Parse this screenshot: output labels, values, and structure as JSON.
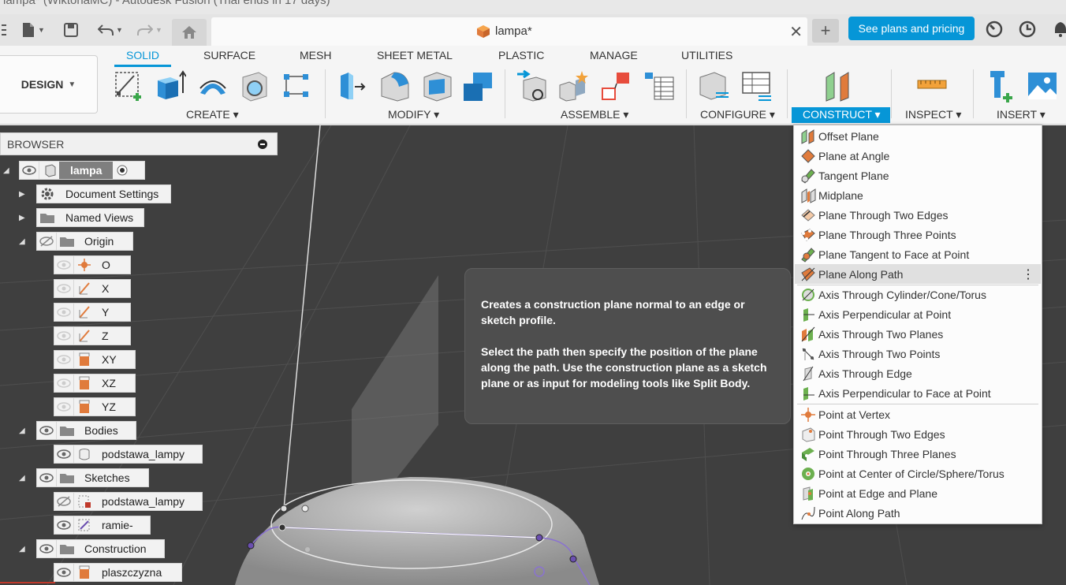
{
  "window": {
    "title": "lampa* (WiktoriaMC) - Autodesk Fusion (Trial ends in 17 days)"
  },
  "tabs": {
    "document": "lampa*",
    "plans_button": "See plans and pricing"
  },
  "ribbon": {
    "workspace": "DESIGN",
    "tabs": [
      "SOLID",
      "SURFACE",
      "MESH",
      "SHEET METAL",
      "PLASTIC",
      "MANAGE",
      "UTILITIES"
    ],
    "groups": {
      "create": "CREATE",
      "modify": "MODIFY",
      "assemble": "ASSEMBLE",
      "configure": "CONFIGURE",
      "construct": "CONSTRUCT",
      "inspect": "INSPECT",
      "insert": "INSERT"
    }
  },
  "browser": {
    "title": "BROWSER",
    "root": "lampa",
    "items": {
      "document_settings": "Document Settings",
      "named_views": "Named Views",
      "origin": "Origin",
      "o": "O",
      "x": "X",
      "y": "Y",
      "z": "Z",
      "xy": "XY",
      "xz": "XZ",
      "yz": "YZ",
      "bodies": "Bodies",
      "body1": "podstawa_lampy",
      "sketches": "Sketches",
      "sketch1": "podstawa_lampy",
      "sketch2": "ramie-",
      "construction": "Construction",
      "construction1": "plaszczyzna"
    }
  },
  "tooltip": {
    "line1": "Creates a construction plane normal to an edge or sketch profile.",
    "line2": "Select the path then specify the position of the plane along the path. Use the construction plane as a sketch plane or as input for modeling tools like Split Body."
  },
  "construct_menu": {
    "planes": [
      "Offset Plane",
      "Plane at Angle",
      "Tangent Plane",
      "Midplane",
      "Plane Through Two Edges",
      "Plane Through Three Points",
      "Plane Tangent to Face at Point",
      "Plane Along Path"
    ],
    "axes": [
      "Axis Through Cylinder/Cone/Torus",
      "Axis Perpendicular at Point",
      "Axis Through Two Planes",
      "Axis Through Two Points",
      "Axis Through Edge",
      "Axis Perpendicular to Face at Point"
    ],
    "points": [
      "Point at Vertex",
      "Point Through Two Edges",
      "Point Through Three Planes",
      "Point at Center of Circle/Sphere/Torus",
      "Point at Edge and Plane",
      "Point Along Path"
    ]
  },
  "colors": {
    "accent": "#0696d7",
    "plane_orange": "#e07b3c",
    "plane_green": "#6cb04f",
    "sketch_purple": "#6b4fb0"
  }
}
